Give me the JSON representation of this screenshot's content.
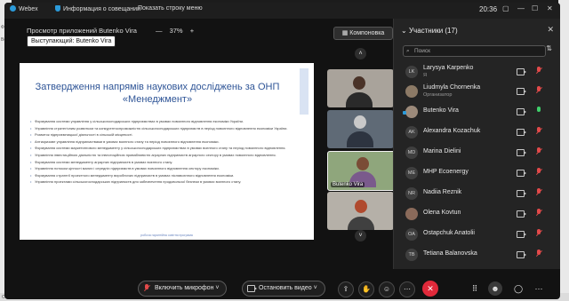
{
  "background_app": {
    "left_labels": [
      "Файл",
      "Встав"
    ],
    "status_left": "Страни"
  },
  "titlebar": {
    "app_name": "Webex",
    "meeting_info": "Информация о совещании",
    "show_menu": "Показать строку меню",
    "time": "20:36"
  },
  "stage": {
    "viewer_title": "Просмотр приложений Butenko Vira",
    "zoom_out_icon": "minus",
    "zoom_level": "37%",
    "zoom_in_icon": "plus",
    "layout_button": "Компоновка",
    "presenter_chip": "Выступающий: Butenko Vira"
  },
  "slide": {
    "title": "Затвердження напрямів наукових досліджень за ОНП «Менеджмент»",
    "items": [
      "Формування системи управління у сільськогосподарських підприємствах в умовах повоєнного відновлення економіки України.",
      "Управління стратегічним розвитком та конкурентоспроможністю сільськогосподарських підприємств в період повоєнного відновлення економіки України.",
      "Розвиток підприємницької діяльності в сільській місцевості.",
      "Антикризове управління підприємствами в умовах воєнного стану та період повоєнного відновлення економіки.",
      "Формування системи маркетингового менеджменту у сільськогосподарських підприємствах в умовах воєнного стану та період повоєнного відновлення.",
      "Управління інвестиційною діяльністю та інвестиційною привабливістю аграрних підприємств аграрного сектору в умовах повоєнного відновлення.",
      "Формування системи менеджменту аграрних підприємств в умовах воєнного стану.",
      "Управління потоком цінності малих і середніх підприємств в умовах повоєнного відновлення сектору економіки.",
      "Формування стратегії проектного менеджменту виробничих підприємств в умовах післявоєнного відновлення економіки.",
      "Управління проектами сільськогосподарських підприємств для забезпечення продовольчої безпеки в умовах воєнного стану."
    ],
    "footer": "робоча гарантійна освітня програма"
  },
  "thumbnails": {
    "labeled_name": "Butenko Vira"
  },
  "participants": {
    "header": "Участники (17)",
    "search_placeholder": "Поиск",
    "list": [
      {
        "initials": "LK",
        "name": "Larysya Karpenko",
        "role": "Я",
        "mic": "muted"
      },
      {
        "initials": "",
        "name": "Liudmyla Chornenka",
        "role": "Организатор",
        "mic": "muted",
        "photo": true
      },
      {
        "initials": "",
        "name": "Butenko Vira",
        "role": "",
        "mic": "on",
        "photo": true,
        "presenting": true
      },
      {
        "initials": "AK",
        "name": "Alexandra Kozachuk",
        "role": "",
        "mic": "muted"
      },
      {
        "initials": "MD",
        "name": "Marina Dielini",
        "role": "",
        "mic": "muted"
      },
      {
        "initials": "ME",
        "name": "MHP Ecoenergy",
        "role": "",
        "mic": "muted"
      },
      {
        "initials": "NR",
        "name": "Nadiia Reznik",
        "role": "",
        "mic": "muted"
      },
      {
        "initials": "",
        "name": "Olena Kovtun",
        "role": "",
        "mic": "muted",
        "photo": true
      },
      {
        "initials": "OA",
        "name": "Ostapchuk Anatolii",
        "role": "",
        "mic": "muted"
      },
      {
        "initials": "TB",
        "name": "Tetiana Balanovska",
        "role": "",
        "mic": "muted"
      }
    ]
  },
  "toolbar": {
    "mic_button": "Включить микрофон",
    "video_button": "Остановить видео"
  },
  "colors": {
    "accent": "#2b9ad9",
    "end_call": "#e0293a",
    "slide_title": "#2f5597"
  }
}
